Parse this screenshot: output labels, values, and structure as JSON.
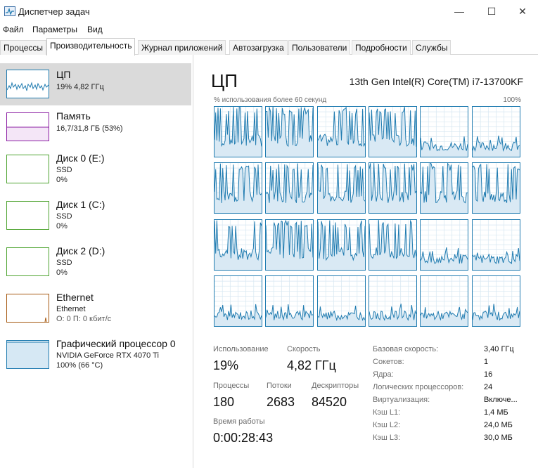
{
  "window": {
    "title": "Диспетчер задач",
    "minimize": "—",
    "maximize": "☐",
    "close": "✕"
  },
  "menu": {
    "file": "Файл",
    "params": "Параметры",
    "view": "Вид"
  },
  "tabs": [
    "Процессы",
    "Производительность",
    "Журнал приложений",
    "Автозагрузка",
    "Пользователи",
    "Подробности",
    "Службы"
  ],
  "sidebar": {
    "cpu": {
      "title": "ЦП",
      "sub": "19% 4,82 ГГц"
    },
    "memory": {
      "title": "Память",
      "sub": "16,7/31,8 ГБ (53%)"
    },
    "disk0": {
      "title": "Диск 0 (E:)",
      "type": "SSD",
      "usage": "0%"
    },
    "disk1": {
      "title": "Диск 1 (C:)",
      "type": "SSD",
      "usage": "0%"
    },
    "disk2": {
      "title": "Диск 2 (D:)",
      "type": "SSD",
      "usage": "0%"
    },
    "ethernet": {
      "title": "Ethernet",
      "sub": "Ethernet",
      "rate": "О: 0 П: 0 кбит/с"
    },
    "gpu": {
      "title": "Графический процессор 0",
      "model": "NVIDIA GeForce RTX 4070 Ti",
      "usage": "100% (66 °C)"
    }
  },
  "colors": {
    "cpu": "#1f7bb0",
    "memory": "#8b1ea3",
    "disk": "#4da32f",
    "ethernet": "#a65a12",
    "gpu": "#1f7bb0",
    "grid": "#cfe3f0"
  },
  "main": {
    "title": "ЦП",
    "model": "13th Gen Intel(R) Core(TM) i7-13700KF",
    "graph_caption": "% использования более 60 секунд",
    "graph_max": "100%"
  },
  "stats": {
    "usage_label": "Использование",
    "usage_value": "19%",
    "speed_label": "Скорость",
    "speed_value": "4,82 ГГц",
    "processes_label": "Процессы",
    "processes_value": "180",
    "threads_label": "Потоки",
    "threads_value": "2683",
    "handles_label": "Дескрипторы",
    "handles_value": "84520",
    "uptime_label": "Время работы",
    "uptime_value": "0:00:28:43"
  },
  "specs": [
    {
      "label": "Базовая скорость:",
      "value": "3,40 ГГц"
    },
    {
      "label": "Сокетов:",
      "value": "1"
    },
    {
      "label": "Ядра:",
      "value": "16"
    },
    {
      "label": "Логических процессоров:",
      "value": "24"
    },
    {
      "label": "Виртуализация:",
      "value": "Включе..."
    },
    {
      "label": "Кэш L1:",
      "value": "1,4 МБ"
    },
    {
      "label": "Кэш L2:",
      "value": "24,0 МБ"
    },
    {
      "label": "Кэш L3:",
      "value": "30,0 МБ"
    }
  ]
}
